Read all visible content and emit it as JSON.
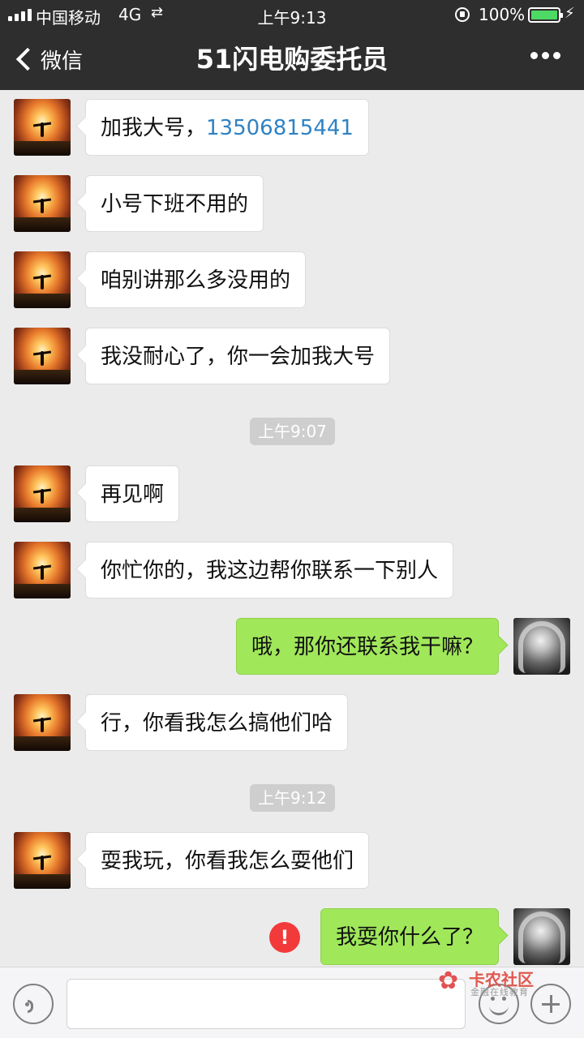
{
  "status_bar": {
    "carrier": "中国移动",
    "network": "4G",
    "time": "上午9:13",
    "battery": "100%"
  },
  "nav": {
    "back_label": "微信",
    "title": "51闪电购委托员"
  },
  "messages": [
    {
      "from": "contact",
      "text": "加我大号，",
      "link": "13506815441"
    },
    {
      "from": "contact",
      "text": "小号下班不用的"
    },
    {
      "from": "contact",
      "text": "咱别讲那么多没用的"
    },
    {
      "from": "contact",
      "text": "我没耐心了，你一会加我大号"
    },
    {
      "type": "time",
      "text": "上午9:07"
    },
    {
      "from": "contact",
      "text": "再见啊"
    },
    {
      "from": "contact",
      "text": "你忙你的，我这边帮你联系一下别人"
    },
    {
      "from": "me",
      "text": "哦，那你还联系我干嘛？"
    },
    {
      "from": "contact",
      "text": "行，你看我怎么搞他们哈"
    },
    {
      "type": "time",
      "text": "上午9:12"
    },
    {
      "from": "contact",
      "text": "耍我玩，你看我怎么耍他们"
    },
    {
      "from": "me",
      "text": "我耍你什么了？",
      "failed": true
    }
  ],
  "watermark": {
    "main": "卡农社区",
    "sub": "金融在线教育"
  },
  "icons": {
    "back": "chevron-left-icon",
    "more": "more-dots-icon",
    "voice": "voice-icon",
    "emoji": "emoji-icon",
    "plus": "plus-icon",
    "error": "error-icon"
  },
  "colors": {
    "header_bg": "#2e2e2e",
    "chat_bg": "#ebebeb",
    "outgoing_bubble": "#a0e75a",
    "incoming_bubble": "#ffffff",
    "link": "#2f82c3",
    "error": "#f23a3a",
    "battery": "#4cd964"
  }
}
